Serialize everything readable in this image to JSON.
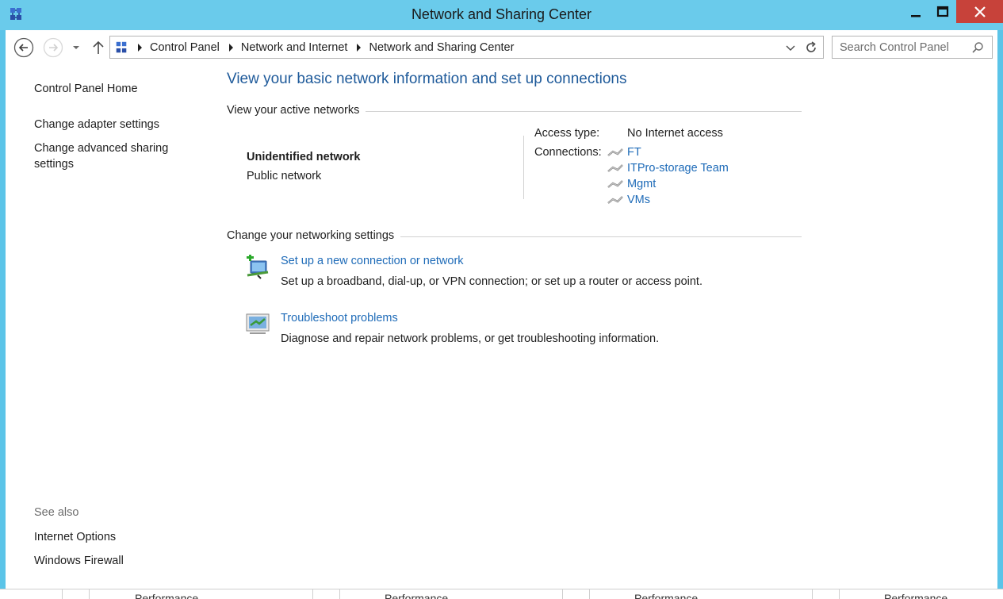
{
  "window": {
    "title": "Network and Sharing Center"
  },
  "address_bar": {
    "crumbs": [
      "Control Panel",
      "Network and Internet",
      "Network and Sharing Center"
    ],
    "search_placeholder": "Search Control Panel"
  },
  "sidebar": {
    "home": "Control Panel Home",
    "links": [
      "Change adapter settings",
      "Change advanced sharing",
      "settings"
    ],
    "see_also_label": "See also",
    "see_also": [
      "Internet Options",
      "Windows Firewall"
    ]
  },
  "main": {
    "title": "View your basic network information and set up connections",
    "active_networks_header": "View your active networks",
    "network": {
      "name": "Unidentified network",
      "type": "Public network",
      "access_type_label": "Access type:",
      "access_type_value": "No Internet access",
      "connections_label": "Connections:",
      "connections": [
        "FT",
        "ITPro-storage Team",
        "Mgmt",
        "VMs"
      ]
    },
    "settings_header": "Change your networking settings",
    "tasks": [
      {
        "title": "Set up a new connection or network",
        "description": "Set up a broadband, dial-up, or VPN connection; or set up a router or access point.",
        "icon": "new-connection-icon"
      },
      {
        "title": "Troubleshoot problems",
        "description": "Diagnose and repair network problems, or get troubleshooting information.",
        "icon": "troubleshoot-icon"
      }
    ]
  },
  "background": {
    "column_labels": [
      "Performance",
      "Performance",
      "Performance",
      "Performance"
    ]
  },
  "colors": {
    "title_bar": "#6acbeb",
    "link": "#1e6bb8",
    "heading": "#1e5a9a",
    "close_button": "#c7423a"
  }
}
